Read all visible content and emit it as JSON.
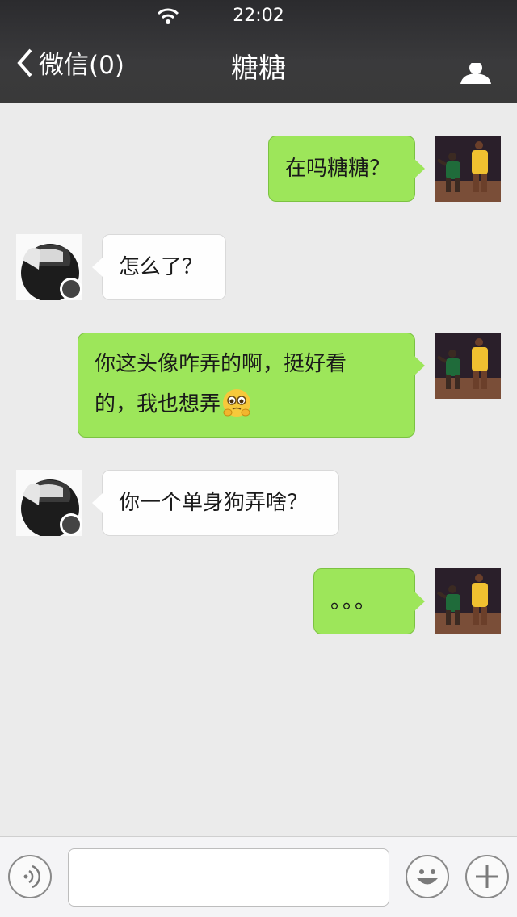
{
  "status_bar": {
    "time": "22:02"
  },
  "nav": {
    "back_label": "微信(0)",
    "title": "糖糖"
  },
  "messages": [
    {
      "side": "out",
      "text": "在吗糖糖？"
    },
    {
      "side": "in",
      "text": "怎么了？"
    },
    {
      "side": "out",
      "line1": "你这头像咋弄的啊，挺好看",
      "line2": "的，我也想弄",
      "emoji": "pleading-face-emoji"
    },
    {
      "side": "in",
      "text": "你一个单身狗弄啥？"
    },
    {
      "side": "out",
      "text": "。。。"
    }
  ],
  "input_bar": {
    "message_value": ""
  },
  "icons": {
    "back": "chevron-left-icon",
    "contact": "person-icon",
    "voice": "voice-icon",
    "emoji": "smiley-icon",
    "more": "plus-icon"
  },
  "colors": {
    "outgoing_bubble": "#9de65a",
    "incoming_bubble": "#fefefe",
    "nav_bar": "#393939",
    "chat_background": "#ebebeb"
  }
}
